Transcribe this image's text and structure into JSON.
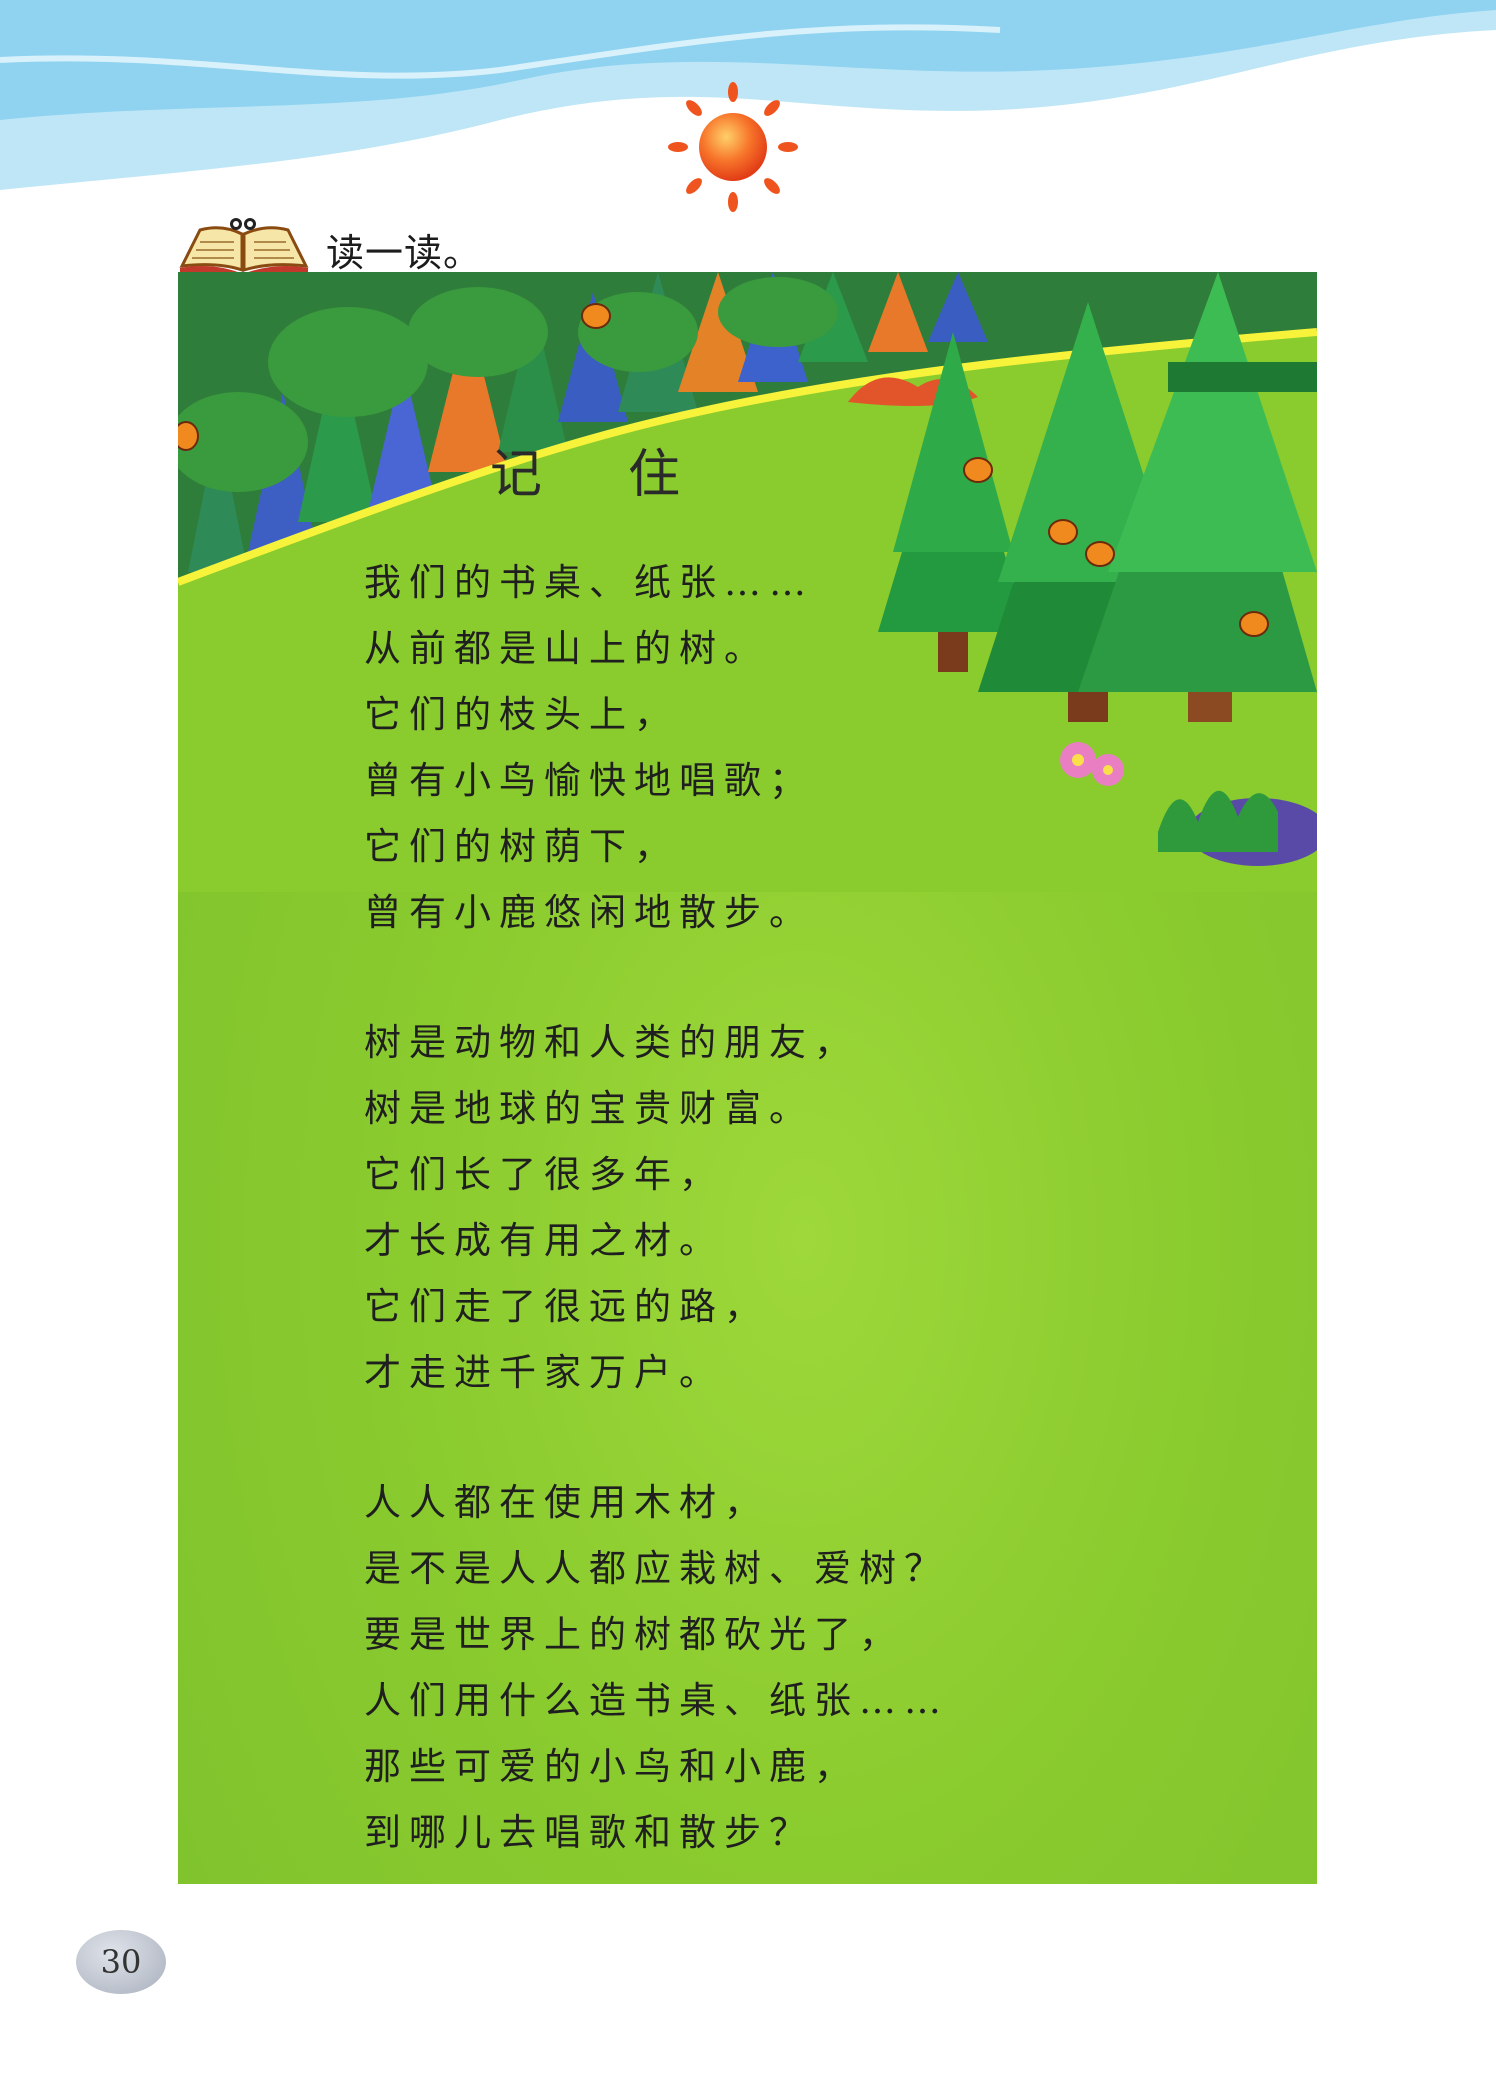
{
  "header": {
    "icon": "book-icon",
    "label": "读一读。"
  },
  "poem": {
    "title_chars": [
      "记",
      "住"
    ],
    "stanzas": [
      [
        "我们的书桌、纸张……",
        "从前都是山上的树。",
        "它们的枝头上，",
        "曾有小鸟愉快地唱歌；",
        "它们的树荫下，",
        "曾有小鹿悠闲地散步。"
      ],
      [
        "树是动物和人类的朋友，",
        "树是地球的宝贵财富。",
        "它们长了很多年，",
        "才长成有用之材。",
        "它们走了很远的路，",
        "才走进千家万户。"
      ],
      [
        "人人都在使用木材，",
        "是不是人人都应栽树、爱树？",
        "要是世界上的树都砍光了，",
        "人们用什么造书桌、纸张……",
        "那些可爱的小鸟和小鹿，",
        "到哪儿去唱歌和散步？"
      ]
    ]
  },
  "page_number": "30",
  "colors": {
    "sky": "#8fd3f0",
    "grass": "#8acb2e",
    "sun": "#f0541e"
  }
}
